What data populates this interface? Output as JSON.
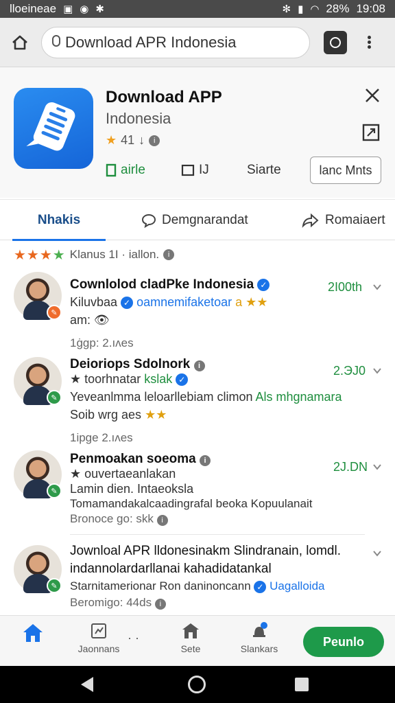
{
  "status_bar": {
    "carrier": "lloeineae",
    "battery": "28%",
    "time": "19:08"
  },
  "browser": {
    "url_text": "Download APR Indonesia"
  },
  "app": {
    "title": "Download APP",
    "subtitle": "Indonesia",
    "rating": "41",
    "actions": [
      {
        "label": "airle",
        "icon": "bookmark-icon"
      },
      {
        "label": "IJ",
        "icon": "square-icon"
      },
      {
        "label": "Siarte",
        "icon": "share-icon"
      }
    ],
    "install_label": "lanc Mnts",
    "accent_color": "#1e8e3e",
    "icon_color": "#1e6fe0"
  },
  "tabs": [
    {
      "label": "Nhakis",
      "active": true
    },
    {
      "label": "Demgnarandat",
      "active": false
    },
    {
      "label": "Romaiaert",
      "active": false
    }
  ],
  "rating_summary": {
    "stars": 4,
    "text": "Klanus 1I · iallon."
  },
  "reviews": [
    {
      "name": "Cownlolod cladPke Indonesia",
      "line1_prefix": "Kiluvbaa",
      "line1_highlight": "oamnemifaketoar",
      "line1_suffix": "a ★★",
      "line2": "am: 👁",
      "meta": "1ġgp: 2.ıʌes",
      "score": "2I00th"
    },
    {
      "name": "Deioriops Sdolnork",
      "line1_prefix": "★ toorhnatar",
      "line1_highlight": "kslak",
      "line1_suffix": "",
      "line2_prefix": "Yeveanlmma leloarllebiam",
      "line2_mid": "climon",
      "line2_highlight": "Als mhgnamara",
      "line3": "Soib wrg aes",
      "meta": "1ipge 2.ıʌes",
      "score": "2.ЭJ0"
    },
    {
      "name": "Penmoakan soeoma",
      "line1": "★ ouvertaeanlakan",
      "line2": "Lamin dien. Intaeoksla",
      "line3": "Tomamandakalcaadingrafal beoka  Kopuulanait",
      "meta": "Bronoce go: skk",
      "score": "2J.DN"
    },
    {
      "name": "Jownloal APR lldonesinakm Slindranain, lomdl.",
      "name2": "indannolardarllanai kahadidatankal",
      "line1_prefix": "Starnitamerionar Ron daninoncann",
      "line1_highlight": "Uagalloida",
      "meta": "Beromigo: 44ds"
    }
  ],
  "bottom_nav": [
    {
      "label": "",
      "icon": "home-icon"
    },
    {
      "label": "Jaonnans",
      "icon": "chart-icon"
    },
    {
      "label": "Sete",
      "icon": "store-icon"
    },
    {
      "label": "Slankars",
      "icon": "notification-icon"
    }
  ],
  "primary_button": "Peunlo"
}
